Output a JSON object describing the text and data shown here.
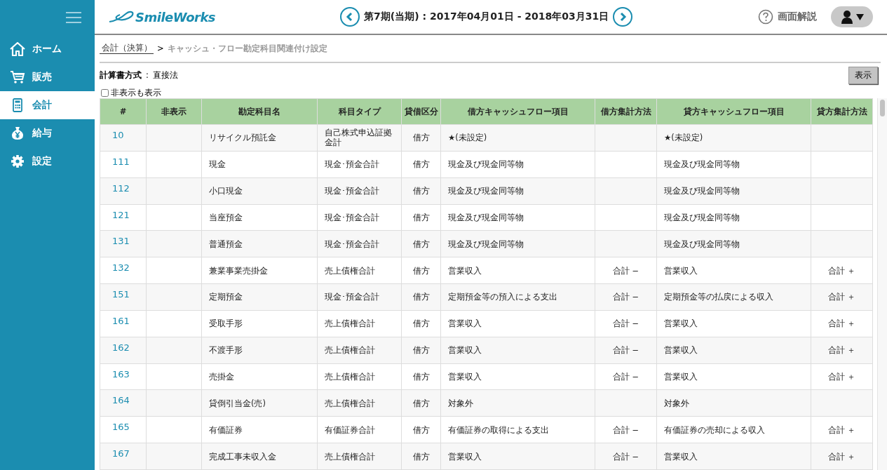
{
  "sidebar": {
    "items": [
      {
        "label": "ホーム",
        "selected": false
      },
      {
        "label": "販売",
        "selected": false
      },
      {
        "label": "会計",
        "selected": true
      },
      {
        "label": "給与",
        "selected": false
      },
      {
        "label": "設定",
        "selected": false
      }
    ]
  },
  "header": {
    "logo": "SmileWorks",
    "period": "第7期(当期) : 2017年04月01日 - 2018年03月31日",
    "help": "画面解説"
  },
  "breadcrumb": {
    "link": "会計（決算）",
    "separator": ">",
    "current": "キャッシュ・フロー勘定科目関連付け設定"
  },
  "method": {
    "label": "計算書方式",
    "separator": ":",
    "value": "直接法"
  },
  "show_hidden": {
    "label": "非表示も表示",
    "checked": false
  },
  "show_button": "表示",
  "table": {
    "columns": [
      "#",
      "非表示",
      "勘定科目名",
      "科目タイプ",
      "貸借区分",
      "借方キャッシュフロー項目",
      "借方集計方法",
      "貸方キャッシュフロー項目",
      "貸方集計方法"
    ],
    "rows": [
      {
        "code": "10",
        "name": "リサイクル預託金",
        "type": "自己株式申込証拠金計",
        "side": "借方",
        "debit_item": "★(未設定)",
        "credit_item": "★(未設定)"
      },
      {
        "code": "111",
        "name": "現金",
        "type": "現金･預金合計",
        "side": "借方",
        "debit_item": "現金及び現金同等物",
        "credit_item": "現金及び現金同等物"
      },
      {
        "code": "112",
        "name": "小口現金",
        "type": "現金･預金合計",
        "side": "借方",
        "debit_item": "現金及び現金同等物",
        "credit_item": "現金及び現金同等物"
      },
      {
        "code": "121",
        "name": "当座預金",
        "type": "現金･預金合計",
        "side": "借方",
        "debit_item": "現金及び現金同等物",
        "credit_item": "現金及び現金同等物"
      },
      {
        "code": "131",
        "name": "普通預金",
        "type": "現金･預金合計",
        "side": "借方",
        "debit_item": "現金及び現金同等物",
        "credit_item": "現金及び現金同等物"
      },
      {
        "code": "132",
        "name": "兼業事業売掛金",
        "type": "売上債権合計",
        "side": "借方",
        "debit_item": "営業収入",
        "debit_method": "合計 −",
        "credit_item": "営業収入",
        "credit_method": "合計 ＋"
      },
      {
        "code": "151",
        "name": "定期預金",
        "type": "現金･預金合計",
        "side": "借方",
        "debit_item": "定期預金等の預入による支出",
        "debit_method": "合計 −",
        "credit_item": "定期預金等の払戻による収入",
        "credit_method": "合計 ＋"
      },
      {
        "code": "161",
        "name": "受取手形",
        "type": "売上債権合計",
        "side": "借方",
        "debit_item": "営業収入",
        "debit_method": "合計 −",
        "credit_item": "営業収入",
        "credit_method": "合計 ＋"
      },
      {
        "code": "162",
        "name": "不渡手形",
        "type": "売上債権合計",
        "side": "借方",
        "debit_item": "営業収入",
        "debit_method": "合計 −",
        "credit_item": "営業収入",
        "credit_method": "合計 ＋"
      },
      {
        "code": "163",
        "name": "売掛金",
        "type": "売上債権合計",
        "side": "借方",
        "debit_item": "営業収入",
        "debit_method": "合計 −",
        "credit_item": "営業収入",
        "credit_method": "合計 ＋"
      },
      {
        "code": "164",
        "name": "貸倒引当金(売)",
        "type": "売上債権合計",
        "side": "借方",
        "debit_item": "対象外",
        "credit_item": "対象外"
      },
      {
        "code": "165",
        "name": "有価証券",
        "type": "有価証券合計",
        "side": "借方",
        "debit_item": "有価証券の取得による支出",
        "debit_method": "合計 −",
        "credit_item": "有価証券の売却による収入",
        "credit_method": "合計 ＋"
      },
      {
        "code": "167",
        "name": "完成工事未収入金",
        "type": "売上債権合計",
        "side": "借方",
        "debit_item": "営業収入",
        "debit_method": "合計 −",
        "credit_item": "営業収入",
        "credit_method": "合計 ＋"
      }
    ]
  }
}
